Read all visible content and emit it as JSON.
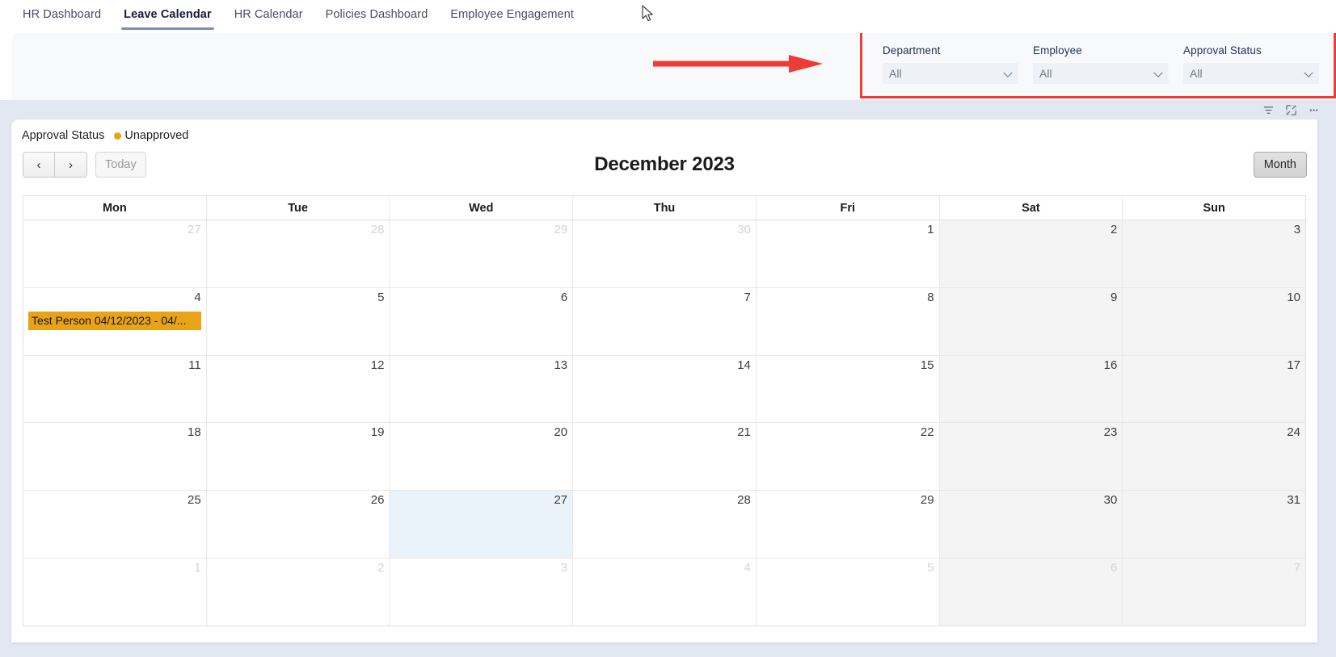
{
  "nav": {
    "tabs": [
      {
        "label": "HR Dashboard",
        "active": false
      },
      {
        "label": "Leave Calendar",
        "active": true
      },
      {
        "label": "HR Calendar",
        "active": false
      },
      {
        "label": "Policies Dashboard",
        "active": false
      },
      {
        "label": "Employee Engagement",
        "active": false
      }
    ]
  },
  "header": {
    "title": "Leave Calendar"
  },
  "filters": {
    "items": [
      {
        "label": "Department",
        "value": "All"
      },
      {
        "label": "Employee",
        "value": "All"
      },
      {
        "label": "Approval Status",
        "value": "All"
      }
    ],
    "highlight_color": "#ef3b36"
  },
  "annotation": {
    "arrow_color": "#ef3b36"
  },
  "card_toolbar": {
    "buttons": [
      {
        "name": "filter-icon",
        "title": "Filter"
      },
      {
        "name": "focus-mode-icon",
        "title": "Focus mode"
      },
      {
        "name": "more-options-icon",
        "title": "More options"
      }
    ]
  },
  "legend": {
    "title": "Approval Status",
    "entries": [
      {
        "label": "Unapproved",
        "color": "#e8a317"
      }
    ]
  },
  "calendar": {
    "prev_label": "‹",
    "next_label": "›",
    "today_label": "Today",
    "title": "December 2023",
    "view_label": "Month",
    "weekdays": [
      "Mon",
      "Tue",
      "Wed",
      "Thu",
      "Fri",
      "Sat",
      "Sun"
    ],
    "weeks": [
      [
        {
          "n": "27",
          "other": true,
          "weekend": false,
          "today": false,
          "events": []
        },
        {
          "n": "28",
          "other": true,
          "weekend": false,
          "today": false,
          "events": []
        },
        {
          "n": "29",
          "other": true,
          "weekend": false,
          "today": false,
          "events": []
        },
        {
          "n": "30",
          "other": true,
          "weekend": false,
          "today": false,
          "events": []
        },
        {
          "n": "1",
          "other": false,
          "weekend": false,
          "today": false,
          "events": []
        },
        {
          "n": "2",
          "other": false,
          "weekend": true,
          "today": false,
          "events": []
        },
        {
          "n": "3",
          "other": false,
          "weekend": true,
          "today": false,
          "events": []
        }
      ],
      [
        {
          "n": "4",
          "other": false,
          "weekend": false,
          "today": false,
          "events": [
            {
              "text": "Test Person 04/12/2023 - 04/...",
              "color": "#e8a317"
            }
          ]
        },
        {
          "n": "5",
          "other": false,
          "weekend": false,
          "today": false,
          "events": []
        },
        {
          "n": "6",
          "other": false,
          "weekend": false,
          "today": false,
          "events": []
        },
        {
          "n": "7",
          "other": false,
          "weekend": false,
          "today": false,
          "events": []
        },
        {
          "n": "8",
          "other": false,
          "weekend": false,
          "today": false,
          "events": []
        },
        {
          "n": "9",
          "other": false,
          "weekend": true,
          "today": false,
          "events": []
        },
        {
          "n": "10",
          "other": false,
          "weekend": true,
          "today": false,
          "events": []
        }
      ],
      [
        {
          "n": "11",
          "other": false,
          "weekend": false,
          "today": false,
          "events": []
        },
        {
          "n": "12",
          "other": false,
          "weekend": false,
          "today": false,
          "events": []
        },
        {
          "n": "13",
          "other": false,
          "weekend": false,
          "today": false,
          "events": []
        },
        {
          "n": "14",
          "other": false,
          "weekend": false,
          "today": false,
          "events": []
        },
        {
          "n": "15",
          "other": false,
          "weekend": false,
          "today": false,
          "events": []
        },
        {
          "n": "16",
          "other": false,
          "weekend": true,
          "today": false,
          "events": []
        },
        {
          "n": "17",
          "other": false,
          "weekend": true,
          "today": false,
          "events": []
        }
      ],
      [
        {
          "n": "18",
          "other": false,
          "weekend": false,
          "today": false,
          "events": []
        },
        {
          "n": "19",
          "other": false,
          "weekend": false,
          "today": false,
          "events": []
        },
        {
          "n": "20",
          "other": false,
          "weekend": false,
          "today": false,
          "events": []
        },
        {
          "n": "21",
          "other": false,
          "weekend": false,
          "today": false,
          "events": []
        },
        {
          "n": "22",
          "other": false,
          "weekend": false,
          "today": false,
          "events": []
        },
        {
          "n": "23",
          "other": false,
          "weekend": true,
          "today": false,
          "events": []
        },
        {
          "n": "24",
          "other": false,
          "weekend": true,
          "today": false,
          "events": []
        }
      ],
      [
        {
          "n": "25",
          "other": false,
          "weekend": false,
          "today": false,
          "events": []
        },
        {
          "n": "26",
          "other": false,
          "weekend": false,
          "today": false,
          "events": []
        },
        {
          "n": "27",
          "other": false,
          "weekend": false,
          "today": true,
          "events": []
        },
        {
          "n": "28",
          "other": false,
          "weekend": false,
          "today": false,
          "events": []
        },
        {
          "n": "29",
          "other": false,
          "weekend": false,
          "today": false,
          "events": []
        },
        {
          "n": "30",
          "other": false,
          "weekend": true,
          "today": false,
          "events": []
        },
        {
          "n": "31",
          "other": false,
          "weekend": true,
          "today": false,
          "events": []
        }
      ],
      [
        {
          "n": "1",
          "other": true,
          "weekend": false,
          "today": false,
          "events": []
        },
        {
          "n": "2",
          "other": true,
          "weekend": false,
          "today": false,
          "events": []
        },
        {
          "n": "3",
          "other": true,
          "weekend": false,
          "today": false,
          "events": []
        },
        {
          "n": "4",
          "other": true,
          "weekend": false,
          "today": false,
          "events": []
        },
        {
          "n": "5",
          "other": true,
          "weekend": false,
          "today": false,
          "events": []
        },
        {
          "n": "6",
          "other": true,
          "weekend": true,
          "today": false,
          "events": []
        },
        {
          "n": "7",
          "other": true,
          "weekend": true,
          "today": false,
          "events": []
        }
      ]
    ]
  }
}
